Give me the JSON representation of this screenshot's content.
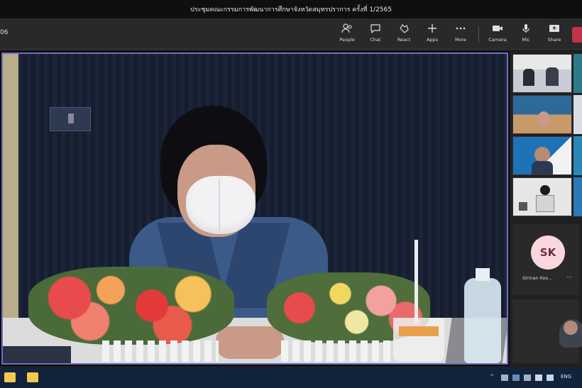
{
  "window": {
    "title": "ประชุมคณะกรรมการพัฒนาการศึกษาจังหวัดสมุทรปราการ ครั้งที่ 1/2565",
    "left_tag": "06"
  },
  "toolbar": {
    "buttons": [
      {
        "label": "People",
        "icon": "people-icon"
      },
      {
        "label": "Chat",
        "icon": "chat-icon"
      },
      {
        "label": "React",
        "icon": "react-icon"
      },
      {
        "label": "Apps",
        "icon": "apps-icon"
      },
      {
        "label": "More",
        "icon": "more-icon"
      },
      {
        "label": "Camera",
        "icon": "camera-icon"
      },
      {
        "label": "Mic",
        "icon": "mic-icon"
      },
      {
        "label": "Share",
        "icon": "share-icon"
      }
    ],
    "leave_color": "#c4314b"
  },
  "main_video": {
    "border_color": "#6b6fc8"
  },
  "participants": {
    "avatar_initials": "SK",
    "avatar_name": "Sirinan Kos...",
    "avatar_more": "⋯"
  },
  "taskbar": {
    "clock": "ENG",
    "tray_label": "^"
  }
}
